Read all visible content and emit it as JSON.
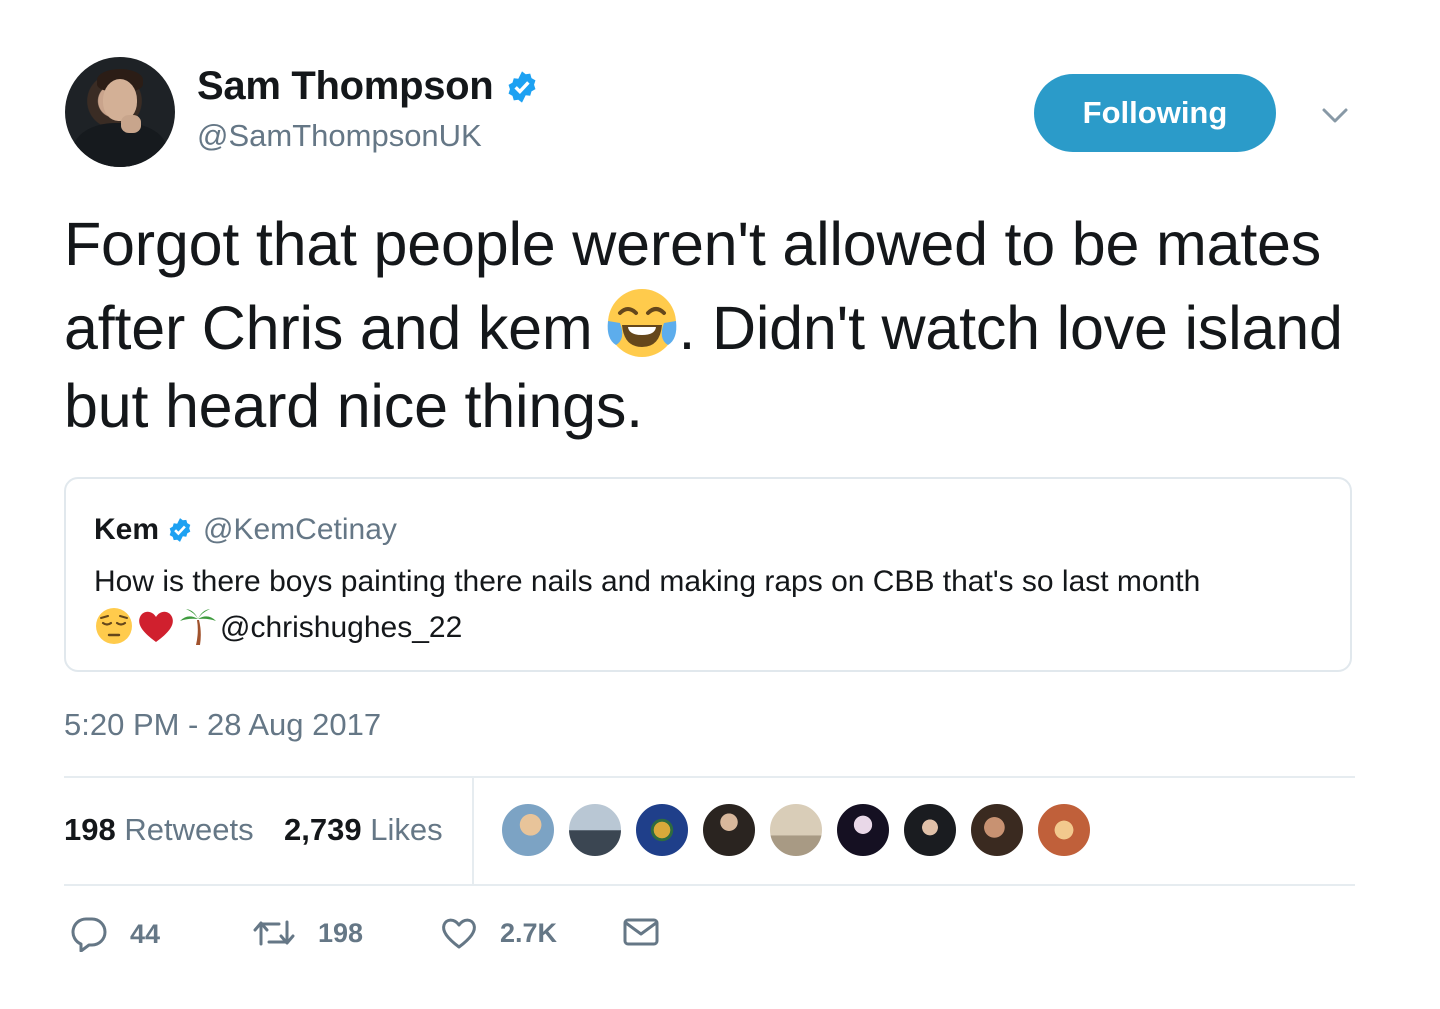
{
  "author": {
    "name": "Sam Thompson",
    "handle": "@SamThompsonUK",
    "avatar_icon": "avatar",
    "verified_icon": "verified-badge-icon"
  },
  "follow_button": {
    "label": "Following"
  },
  "menu": {
    "icon": "chevron-down-icon"
  },
  "tweet": {
    "text_part1": "Forgot that people weren't allowed to be mates after Chris and kem",
    "emoji": "face-with-tears-of-joy-emoji",
    "text_part2": ". Didn't watch love island but heard nice things."
  },
  "quoted_tweet": {
    "name": "Kem",
    "handle": "@KemCetinay",
    "text": "How is there boys painting there nails and making raps on CBB that's so last month",
    "emojis": [
      "pensive-face-emoji",
      "red-heart-emoji",
      "palm-tree-emoji"
    ],
    "mention": "@chrishughes_22"
  },
  "timestamp": "5:20 PM - 28 Aug 2017",
  "stats": {
    "retweets_count": "198",
    "retweets_label": "Retweets",
    "likes_count": "2,739",
    "likes_label": "Likes"
  },
  "likers_count_shown": 9,
  "actions": {
    "reply": {
      "icon": "reply-icon",
      "count": "44"
    },
    "retweet": {
      "icon": "retweet-icon",
      "count": "198"
    },
    "like": {
      "icon": "heart-icon",
      "count": "2.7K"
    },
    "message": {
      "icon": "envelope-icon"
    }
  },
  "colors": {
    "accent": "#2b9bc9",
    "secondary_text": "#657786",
    "verified": "#1da1f2"
  }
}
